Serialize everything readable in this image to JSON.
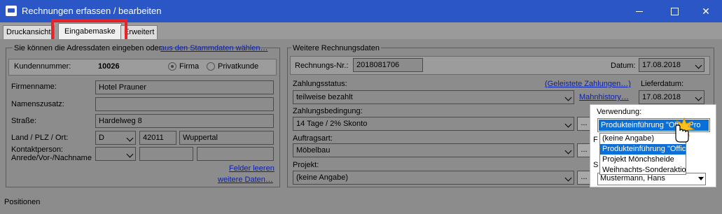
{
  "window": {
    "title": "Rechnungen erfassen / bearbeiten"
  },
  "tabs": [
    {
      "label": "Druckansicht"
    },
    {
      "label": "Eingabemaske"
    },
    {
      "label": "Erweitert"
    }
  ],
  "address": {
    "intro": "Sie können die Adressdaten eingeben oder",
    "intro_link": "aus den Stammdaten wählen…",
    "customer_no_label": "Kundennummer:",
    "customer_no": "10026",
    "radio_firma": "Firma",
    "radio_privat": "Privatkunde",
    "company_label": "Firmenname:",
    "company": "Hotel Prauner",
    "name_suffix_label": "Namenszusatz:",
    "name_suffix": "",
    "street_label": "Straße:",
    "street": "Hardelweg 8",
    "country_zip_city_label": "Land / PLZ / Ort:",
    "country": "D",
    "zip": "42011",
    "city": "Wuppertal",
    "contact_label_1": "Kontaktperson:",
    "contact_label_2": "Anrede/Vor-/Nachname",
    "clear_link": "Felder leeren",
    "more_link": "weitere Daten…"
  },
  "invoice": {
    "group_title": "Weitere Rechnungsdaten",
    "invoice_no_label": "Rechnungs-Nr.:",
    "invoice_no": "2018081706",
    "date_label": "Datum:",
    "date": "17.08.2018",
    "payment_status_label": "Zahlungsstatus:",
    "paid_link": "(Geleistete Zahlungen…)",
    "payment_status": "teilweise bezahlt",
    "dunning_link": "Mahnhistory…",
    "delivery_date_label": "Lieferdatum:",
    "delivery_date": "17.08.2018",
    "payment_terms_label": "Zahlungsbedingung:",
    "payment_terms": "14 Tage / 2% Skonto",
    "order_type_label": "Auftragsart:",
    "order_type": "Möbelbau",
    "project_label": "Projekt:",
    "project": "(keine Angabe)",
    "ellipsis": "..."
  },
  "usage_popup": {
    "label": "Verwendung:",
    "selected": "Produkteinführung \"OfficePro",
    "options": [
      "(keine Angabe)",
      "Produkteinführung \"OfficePro",
      "Projekt Mönchsheide",
      "Weihnachts-Sonderaktion"
    ],
    "selected_index": 1,
    "side_chars": [
      "F",
      "S"
    ],
    "underfield": "Mustermann, Hans"
  },
  "positions_label": "Positionen"
}
